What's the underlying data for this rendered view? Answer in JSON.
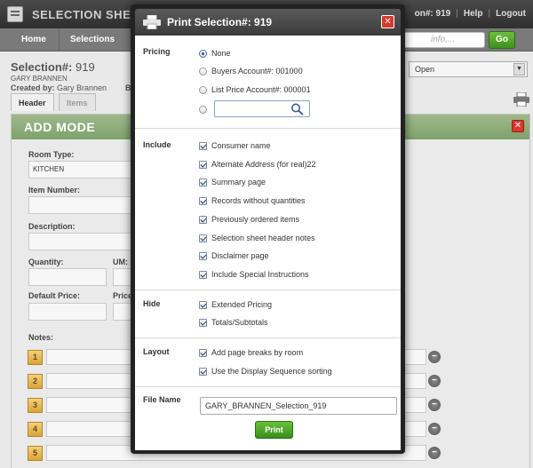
{
  "app": {
    "title": "SELECTION SHEET MA",
    "top_right": {
      "selection_ref": "on#: 919",
      "help": "Help",
      "logout": "Logout"
    }
  },
  "nav": {
    "items": [
      "Home",
      "Selections"
    ],
    "search_placeholder": "info,...",
    "go_label": "Go"
  },
  "selection": {
    "title_label": "Selection#:",
    "title_value": "919",
    "customer": "GARY BRANNEN",
    "created_by_label": "Created by:",
    "created_by_value": "Gary Brannen",
    "truncated_label": "B",
    "status": "Open"
  },
  "tabs": [
    "Header",
    "Items"
  ],
  "panel": {
    "title": "ADD MODE",
    "fields": {
      "room_type_label": "Room Type:",
      "room_type_value": "KITCHEN",
      "item_number_label": "Item Number:",
      "description_label": "Description:",
      "quantity_label": "Quantity:",
      "um_label": "UM:",
      "default_price_label": "Default Price:",
      "price_label_trunc": "Price",
      "notes_label": "Notes:"
    },
    "note_numbers": [
      "1",
      "2",
      "3",
      "4",
      "5"
    ],
    "minus_glyph": "−"
  },
  "modal": {
    "title": "Print Selection#: 919",
    "close_glyph": "✕",
    "pricing": {
      "label": "Pricing",
      "options": [
        {
          "text": "None",
          "selected": true
        },
        {
          "text": "Buyers Account#: 001000",
          "selected": false
        },
        {
          "text": "List Price Account#: 000001",
          "selected": false
        }
      ]
    },
    "include": {
      "label": "Include",
      "items": [
        "Consumer name",
        "Alternate Address (for real)22",
        "Summary page",
        "Records without quantities",
        "Previously ordered items",
        "Selection sheet header notes",
        "Disclaimer page",
        "Include Special Instructions"
      ]
    },
    "hide": {
      "label": "Hide",
      "items": [
        "Extended Pricing",
        "Totals/Subtotals"
      ]
    },
    "layout": {
      "label": "Layout",
      "items": [
        "Add page breaks by room",
        "Use the Display Sequence sorting"
      ]
    },
    "file_name": {
      "label": "File Name",
      "value": "GARY_BRANNEN_Selection_919"
    },
    "print_label": "Print"
  },
  "colors": {
    "go_green": "#4aa526",
    "panel_header": "#8cae79",
    "close_red": "#d9382e",
    "note_badge": "#e6b955"
  }
}
